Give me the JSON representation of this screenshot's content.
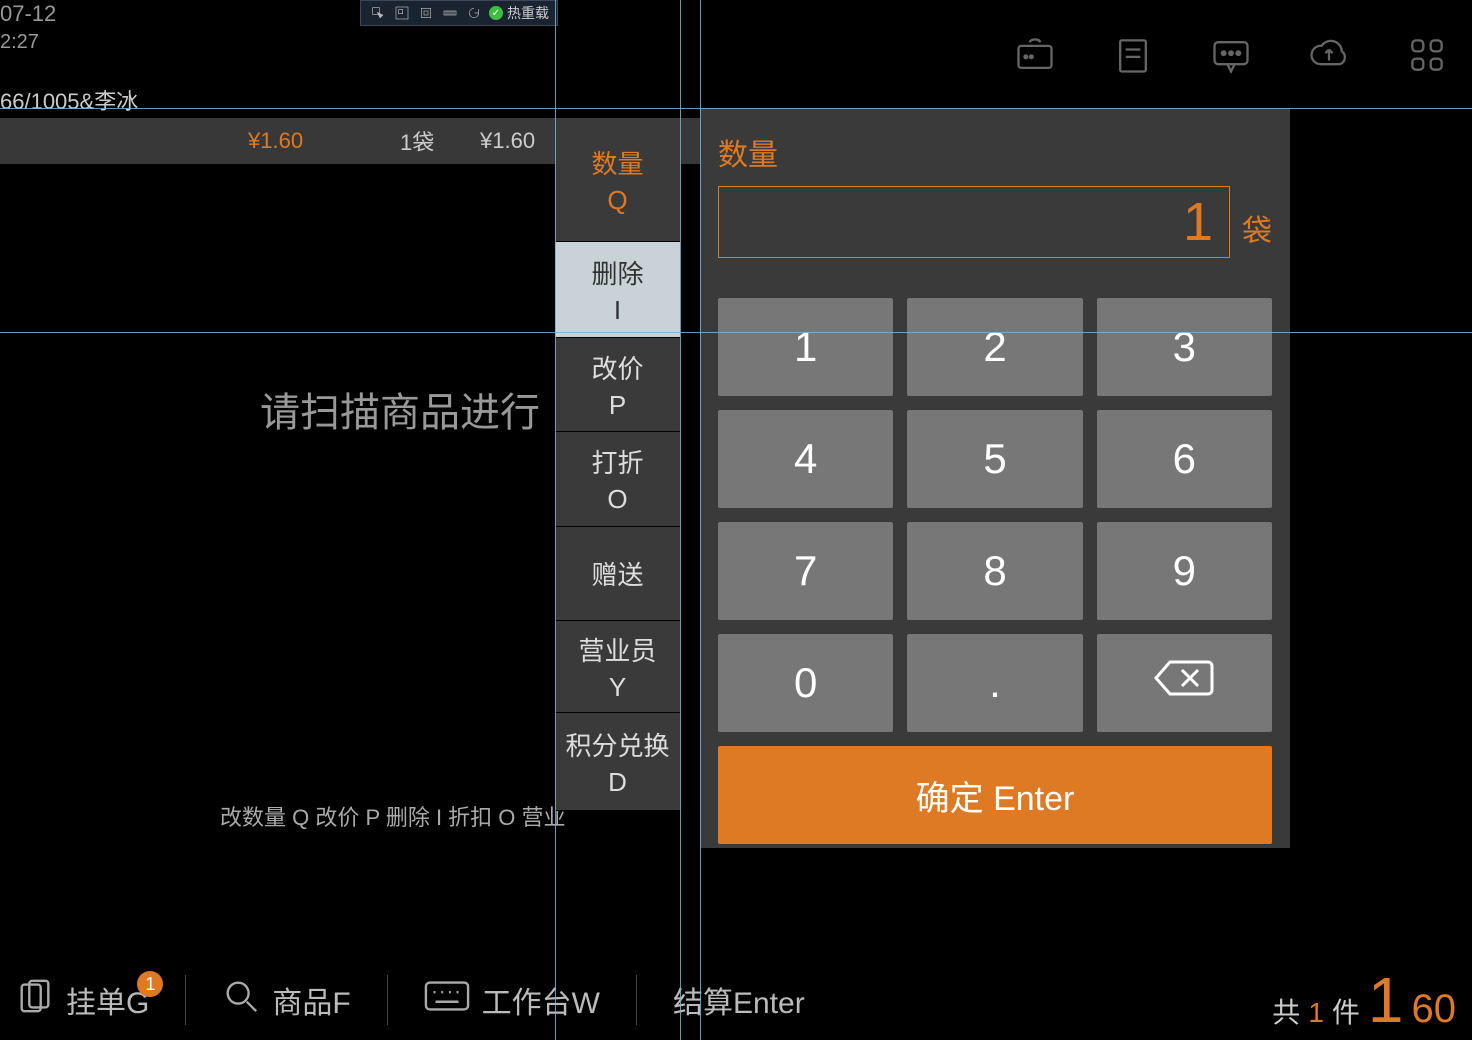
{
  "meta": {
    "date": "07-12",
    "time": "2:27"
  },
  "dev_toolbar": {
    "hotreload": "热重载"
  },
  "userline": "66/1005&李冰",
  "item": {
    "price1": "¥1.60",
    "qty": "1袋",
    "price2": "¥1.60"
  },
  "center_msg": "请扫描商品进行",
  "shortcuts_line": "改数量 Q 改价 P 删除 I 折扣 O 营业",
  "side_actions": [
    {
      "label": "数量",
      "sub": "Q"
    },
    {
      "label": "删除",
      "sub": "I"
    },
    {
      "label": "改价",
      "sub": "P"
    },
    {
      "label": "打折",
      "sub": "O"
    },
    {
      "label": "赠送",
      "sub": ""
    },
    {
      "label": "营业员",
      "sub": "Y"
    },
    {
      "label": "积分兑换",
      "sub": "D"
    }
  ],
  "keypad": {
    "title": "数量",
    "value": "1",
    "unit": "袋",
    "keys": [
      "1",
      "2",
      "3",
      "4",
      "5",
      "6",
      "7",
      "8",
      "9",
      "0",
      ".",
      "backspace"
    ],
    "confirm": "确定 Enter"
  },
  "bottom": {
    "hold": "挂单G",
    "hold_badge": "1",
    "product": "商品F",
    "workbench": "工作台W",
    "checkout": "结算Enter",
    "summary_prefix": "共",
    "summary_count": "1",
    "summary_unit": "件",
    "summary_total": "60"
  },
  "guides": {
    "h": [
      108,
      332
    ],
    "v": [
      555,
      680,
      700
    ]
  }
}
